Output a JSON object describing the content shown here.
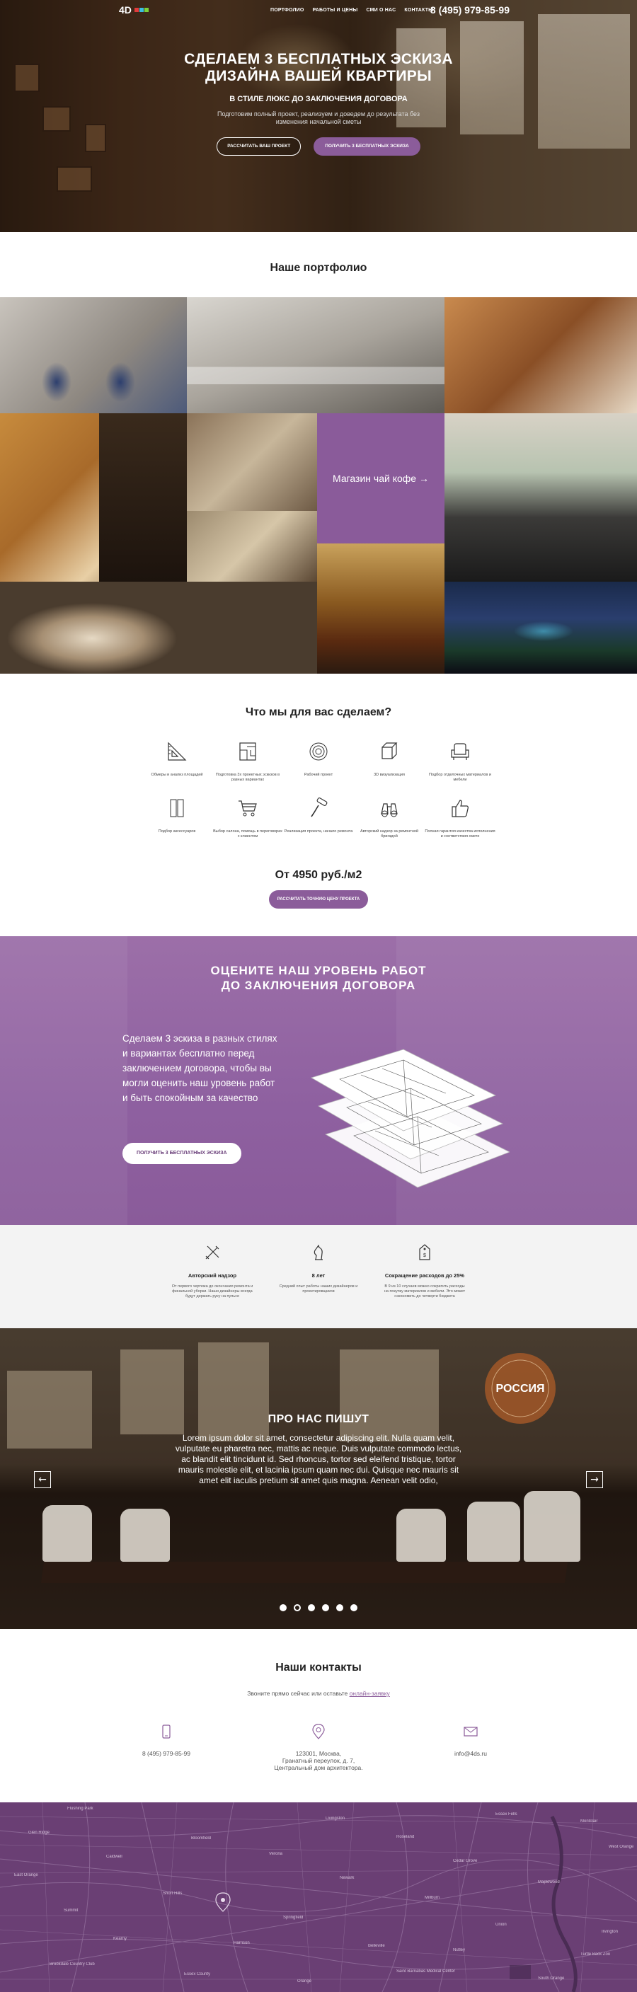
{
  "header": {
    "logo_text": "4D",
    "menu": [
      "ПОРТФОЛИО",
      "РАБОТЫ И ЦЕНЫ",
      "СМИ О НАС",
      "КОНТАКТЫ"
    ],
    "phone": "8 (495) 979-85-99"
  },
  "hero": {
    "title_line1": "СДЕЛАЕМ 3 БЕСПЛАТНЫХ ЭСКИЗА",
    "title_line2": "ДИЗАЙНА ВАШЕЙ КВАРТИРЫ",
    "subtitle": "В СТИЛЕ ЛЮКС ДО ЗАКЛЮЧЕНИЯ ДОГОВОРА",
    "text": "Подготовим полный проект, реализуем и доведем до результата без изменения начальной сметы",
    "btn_calc": "РАССЧИТАТЬ ВАШ ПРОЕКТ",
    "btn_sketches": "ПОЛУЧИТЬ 3 БЕСПЛАТНЫХ ЭСКИЗА"
  },
  "portfolio": {
    "title": "Наше портфолио",
    "featured_label": "Магазин чай кофе →"
  },
  "services": {
    "title": "Что мы для вас сделаем?",
    "row1": [
      {
        "icon": "ruler-triangle-icon",
        "label": "Обмеры и анализ площадей"
      },
      {
        "icon": "floorplan-icon",
        "label": "Подготовка 3х проектных эскизов в разных вариантах"
      },
      {
        "icon": "target-icon",
        "label": "Рабочий проект"
      },
      {
        "icon": "cube-icon",
        "label": "3D визуализация"
      },
      {
        "icon": "armchair-icon",
        "label": "Подбор отделочных материалов и мебели"
      }
    ],
    "row2": [
      {
        "icon": "panels-icon",
        "label": "Подбор аксессуаров"
      },
      {
        "icon": "cart-icon",
        "label": "Выбор салона, помощь в переговорах с клиентом"
      },
      {
        "icon": "paint-roller-icon",
        "label": "Реализация проекта, начало ремонта"
      },
      {
        "icon": "binoculars-icon",
        "label": "Авторский надзор за ремонтной бригадой"
      },
      {
        "icon": "thumbs-up-icon",
        "label": "Полная гарантия качества исполнения и соответствия смете"
      }
    ],
    "price": "От 4950 руб./м2",
    "price_button": "РАССЧИТАТЬ ТОЧНУЮ ЦЕНУ ПРОЕКТА"
  },
  "evaluate": {
    "title_line1": "ОЦЕНИТЕ НАШ УРОВЕНЬ РАБОТ",
    "title_line2": "ДО ЗАКЛЮЧЕНИЯ ДОГОВОРА",
    "text": "Сделаем 3 эскиза в разных стилях и вариантах бесплатно перед заключением договора, чтобы вы могли оценить наш уровень работ и быть спокойным за качество",
    "button": "ПОЛУЧИТЬ 3 БЕСПЛАТНЫХ ЭСКИЗА"
  },
  "features": [
    {
      "icon": "tools-icon",
      "title": "Авторский надзор",
      "text": "От первого чертежа до окончания ремонта и финальной уборки. Наши дизайнеры всегда будут держать руку на пульсе"
    },
    {
      "icon": "chess-knight-icon",
      "title": "8 лет",
      "text": "Средний опыт работы наших дизайнеров и проектировщиков"
    },
    {
      "icon": "price-tag-icon",
      "title": "Сокращение расходов до 25%",
      "text": "В 9 из 10 случаев можно сократить расходы на покупку материалов и мебели. Это может сэкономить до четверти бюджета"
    }
  ],
  "reviews": {
    "title": "ПРО НАС ПИШУТ",
    "text": "Lorem ipsum dolor sit amet, consectetur adipiscing elit. Nulla quam velit, vulputate eu pharetra nec, mattis ac neque. Duis vulputate commodo lectus, ac blandit elit tincidunt id. Sed rhoncus, tortor sed eleifend tristique, tortor mauris molestie elit, et lacinia ipsum quam nec dui. Quisque nec mauris sit amet elit iaculis pretium sit amet quis magna. Aenean velit odio,",
    "prev": "←",
    "next": "→",
    "slides": 6,
    "active_slide": 2,
    "sign_text": "РОССИЯ"
  },
  "contacts": {
    "title": "Наши контакты",
    "sub_text": "Звоните прямо сейчас или оставьте ",
    "sub_link": "онлайн-заявку",
    "phone": "8 (495) 979-85-99",
    "address": "123001, Москва,\nГранатный переулок, д. 7,\nЦентральный дом архитектора.",
    "email": "info@4ds.ru"
  },
  "map": {
    "labels": [
      "Flushing Park",
      "Livingston",
      "Essex Fells",
      "Montclair",
      "Glen Ridge",
      "Bloomfield",
      "Roseland",
      "West Orange",
      "Caldwell",
      "Verona",
      "Cedar Grove",
      "East Orange",
      "Newark",
      "Maplewood",
      "Short Hills",
      "Millburn",
      "Summit",
      "Springfield",
      "Union",
      "Irvington",
      "Kearny",
      "Harrison",
      "Belleville",
      "Nutley",
      "Saint Barnabas Medical Center",
      "Brookdale Country Club",
      "Essex County",
      "Orange",
      "South Orange",
      "Turtle Back Zoo"
    ]
  },
  "colors": {
    "accent": "#8b5c9a",
    "accent_dark": "#6a3f7a"
  }
}
